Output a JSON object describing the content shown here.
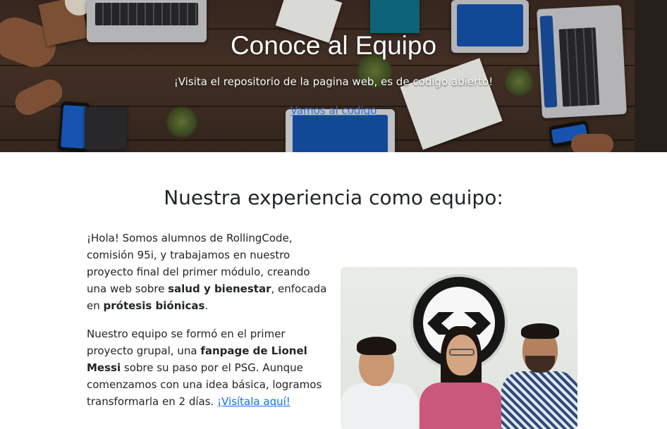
{
  "hero": {
    "title": "Conoce al Equipo",
    "subtitle": "¡Visita el repositorio de la pagina web, es de codigo abierto!",
    "link_label": "Vamos al codigo"
  },
  "experience": {
    "title": "Nuestra experiencia como equipo:",
    "p1": {
      "t1": "¡Hola! Somos alumnos de RollingCode, comisión 95i, y trabajamos en nuestro proyecto final del primer módulo, creando una web sobre ",
      "b1": "salud y bienestar",
      "t2": ", enfocada en ",
      "b2": "prótesis biónicas",
      "t3": "."
    },
    "p2": {
      "t1": "Nuestro equipo se formó en el primer proyecto grupal, una ",
      "b1": "fanpage de Lionel Messi",
      "t2": " sobre su paso por el PSG. Aunque comenzamos con una idea básica, logramos transformarla en 2 días. ",
      "link": "¡Visítala aquí!"
    }
  },
  "colors": {
    "link": "#0d6efd",
    "hero_link": "#2f6fd8",
    "text": "#212529"
  }
}
